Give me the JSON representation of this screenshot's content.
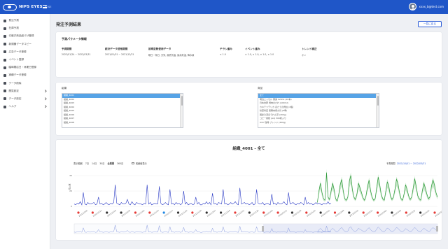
{
  "app": {
    "logo_text": "NIPS EYES",
    "logo_sub": "ROSE",
    "user": "xxxx_b@test.com"
  },
  "sidebar": {
    "items": [
      {
        "label": "発注予測",
        "chev": false
      },
      {
        "label": "在庫予測",
        "chev": false
      },
      {
        "label": "引継ぎ商品紐づけ登録",
        "chev": false
      },
      {
        "label": "新規棚データコピー",
        "chev": false
      },
      {
        "label": "広告データ登録",
        "chev": false
      },
      {
        "label": "イベント登録",
        "chev": false
      },
      {
        "label": "臨時閉店日・休業日登録",
        "chev": false
      },
      {
        "label": "実績データ登録",
        "chev": false
      },
      {
        "label": "データ削除",
        "chev": false
      },
      {
        "label": "閲覧設定",
        "chev": true
      },
      {
        "label": "データ設定",
        "chev": true
      },
      {
        "label": "ヘルプ",
        "chev": true
      }
    ]
  },
  "page": {
    "title": "発注予測結果",
    "back_button": "一覧に戻る"
  },
  "params": {
    "title": "予測パラメータ情報",
    "items": [
      {
        "label": "予測期間",
        "value": "2022/01/24 ~ 2022/03/31"
      },
      {
        "label": "統計データ使用期間",
        "value": "2021/01/01 ~ 2021/12/31"
      },
      {
        "label": "説明変数使用データ",
        "value": "曜日・特日, 天気, 最低気温, 最高気温, 降水量"
      },
      {
        "label": "チラシ重み",
        "value": "× 1.0"
      },
      {
        "label": "イベント重み",
        "value": "× 1.0, × 1.0, × 1.0, × 1.0"
      },
      {
        "label": "トレンド補正",
        "value": "オン"
      }
    ]
  },
  "lists": {
    "left": {
      "label": "組織",
      "items": [
        "組織_4001",
        "組織_4002",
        "組織_4003",
        "組織_4004",
        "組織_4005",
        "組織_4006",
        "組織_4007",
        "組織_4008"
      ],
      "selected": 0
    },
    "right": {
      "label": "商品",
      "items": [
        "全て",
        "明治エッセル 果実 120ml (10本)",
        "日本食研 焼肉のたれ (100ml)",
        "カネテツデリカ ほたての貝柱 (4個)",
        "秋葉商店 鶏胸肉焼き鳥 (6串)",
        "国産冷凍ほうれん草 (200g)",
        "コピー用紙 (A4) 500枚入り",
        "UCC 珈琲 ブレンド (200g)"
      ],
      "selected": 0
    }
  },
  "chart": {
    "title": "組織_4001 - 全て",
    "controls": [
      "表示範囲",
      "7日",
      "14日",
      "30日",
      "全期間",
      "365日"
    ],
    "active_control": 4,
    "actual_label": "実績値表示",
    "period_label": "予測期間",
    "period_value": "2021/10/01 ~ 2022/03/31",
    "ylabel": "売上数",
    "colors": {
      "actual": "#2b3bc5",
      "forecast": "#2e9a3a",
      "band": "#9bd49f",
      "navigator": "#8a9ce0"
    }
  },
  "chart_data": {
    "type": "line",
    "ylabel": "売上数",
    "yticks": [
      0,
      20,
      40
    ],
    "ylim": [
      0,
      50
    ],
    "series": [
      {
        "key": "actual",
        "values": [
          3,
          2,
          4,
          3,
          6,
          2,
          18,
          3,
          2,
          5,
          3,
          3,
          4,
          5,
          2,
          3,
          12,
          3,
          4,
          2,
          3,
          5,
          3,
          2,
          4,
          3,
          5,
          28,
          4,
          3,
          2,
          5,
          3,
          3,
          4,
          9,
          3,
          2,
          6,
          3,
          2,
          5,
          4,
          3,
          3,
          2,
          4,
          3,
          28,
          3,
          5,
          2,
          3,
          4,
          3,
          3,
          26,
          4,
          2,
          3,
          5,
          3,
          2,
          22,
          3,
          4,
          2,
          5,
          3,
          4,
          2,
          4,
          20,
          3,
          5,
          2,
          3,
          4,
          2,
          3,
          12,
          3,
          5,
          2,
          2,
          4,
          3,
          6,
          3,
          5,
          2,
          17,
          3,
          4,
          2,
          5,
          4,
          3,
          22,
          3,
          4,
          2,
          3,
          5,
          3,
          4,
          6,
          3,
          2,
          24,
          3,
          4,
          5,
          3,
          4,
          2,
          3,
          5,
          2,
          3,
          22,
          4,
          3,
          3,
          5,
          2,
          3,
          4,
          3,
          2,
          16,
          3,
          4,
          2,
          5,
          3,
          3,
          4,
          6,
          3,
          2,
          18,
          3,
          4,
          5,
          3,
          2,
          4,
          3,
          5,
          4,
          2,
          12,
          3,
          5,
          3,
          4,
          2,
          3,
          5,
          3,
          4,
          3,
          2,
          4,
          3,
          3,
          6,
          3,
          4
        ]
      },
      {
        "key": "forecast",
        "values": [
          5,
          20,
          30,
          18,
          10,
          8,
          44,
          12,
          9,
          20,
          30,
          22,
          10,
          7,
          15,
          28,
          35,
          20,
          10,
          8,
          12,
          33,
          40,
          22,
          12,
          9,
          16,
          30,
          24,
          18,
          11,
          8,
          14,
          26,
          34,
          20,
          12,
          8,
          10,
          24,
          38,
          28,
          15,
          10,
          8,
          20,
          32,
          26,
          14,
          9,
          12,
          22,
          35,
          30,
          18,
          10,
          8,
          16,
          28,
          22,
          14,
          9,
          12,
          24,
          36,
          26,
          14,
          10,
          8,
          20,
          30,
          24,
          16,
          10,
          12,
          26,
          34,
          28,
          18,
          12
        ]
      }
    ],
    "annotations": [
      "2021/10/05",
      "2021/10/12",
      "2021/10/19",
      "2021/10/26",
      "2021/11/03",
      "2021/11/10",
      "2021/11/17",
      "2021/11/23",
      "2021/11/30",
      "2021/12/07",
      "2021/12/14",
      "2021/12/21",
      "2021/12/28",
      "2022/01/04",
      "2022/01/11",
      "2022/01/18",
      "2022/01/25",
      "2022/02/01",
      "2022/02/08",
      "2022/02/15",
      "2022/02/22",
      "2022/03/01",
      "2022/03/08",
      "2022/03/15",
      "2022/03/22",
      "2022/03/29"
    ]
  }
}
